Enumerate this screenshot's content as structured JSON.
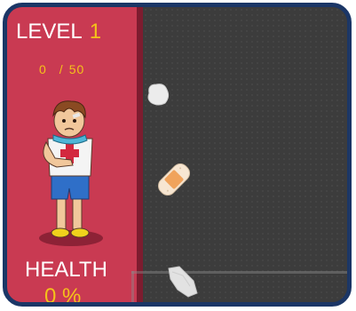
{
  "hud": {
    "level_label": "LEVEL",
    "level_value": "1",
    "progress_current": "0",
    "progress_separator": "/",
    "progress_total": "50",
    "health_label": "HEALTH",
    "health_value": "0 %"
  },
  "game_state": {
    "level": 1,
    "items_collected": 0,
    "items_target": 50,
    "health_percent": 0
  },
  "colors": {
    "panel": "#c93a52",
    "panel_edge": "#7d1c2f",
    "play_area": "#3c3c3c",
    "frame_border": "#1b3666",
    "accent_text": "#f4c21a",
    "label_text": "#ffffff"
  },
  "icons": {
    "character": "injured-boy-character",
    "item_1": "cotton-ball-icon",
    "item_2": "bandage-icon",
    "item_3": "gauze-icon"
  }
}
